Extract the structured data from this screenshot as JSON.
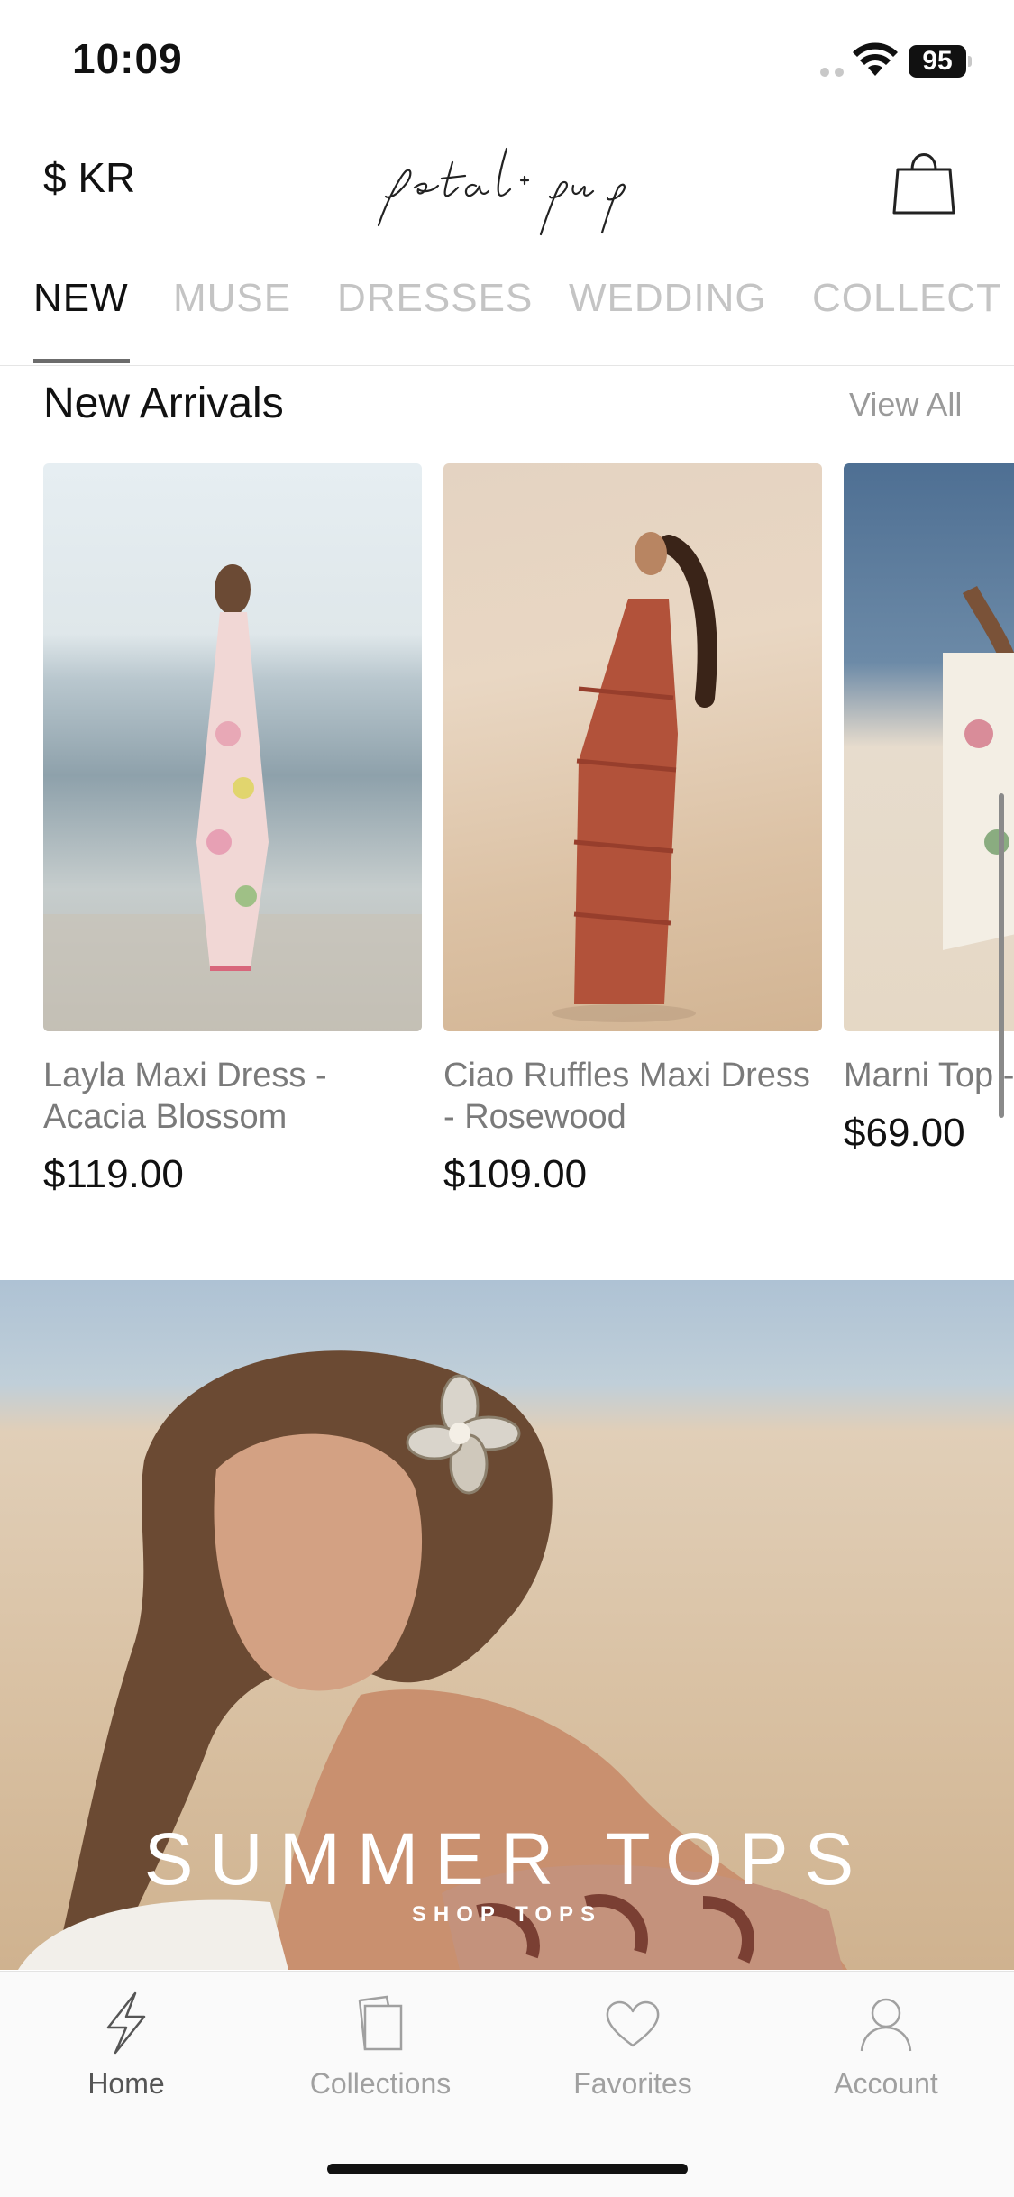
{
  "status_bar": {
    "time": "10:09",
    "battery": "95"
  },
  "header": {
    "currency": "$ KR",
    "logo_alt": "petal + pup"
  },
  "tabs": [
    {
      "label": "NEW",
      "active": true
    },
    {
      "label": "MUSE",
      "active": false
    },
    {
      "label": "DRESSES",
      "active": false
    },
    {
      "label": "WEDDING",
      "active": false
    },
    {
      "label": "COLLECT",
      "active": false
    }
  ],
  "section": {
    "title": "New Arrivals",
    "view_all": "View All"
  },
  "products": [
    {
      "name": "Layla Maxi Dress - Acacia Blossom",
      "price": "$119.00"
    },
    {
      "name": "Ciao Ruffles Maxi Dress - Rosewood",
      "price": "$109.00"
    },
    {
      "name": "Marni Top - Flora",
      "price": "$69.00"
    }
  ],
  "banner": {
    "title": "SUMMER TOPS",
    "subtitle": "SHOP TOPS"
  },
  "bottom_nav": [
    {
      "label": "Home",
      "icon": "lightning-icon",
      "active": true
    },
    {
      "label": "Collections",
      "icon": "collections-icon",
      "active": false
    },
    {
      "label": "Favorites",
      "icon": "heart-icon",
      "active": false
    },
    {
      "label": "Account",
      "icon": "account-icon",
      "active": false
    }
  ]
}
